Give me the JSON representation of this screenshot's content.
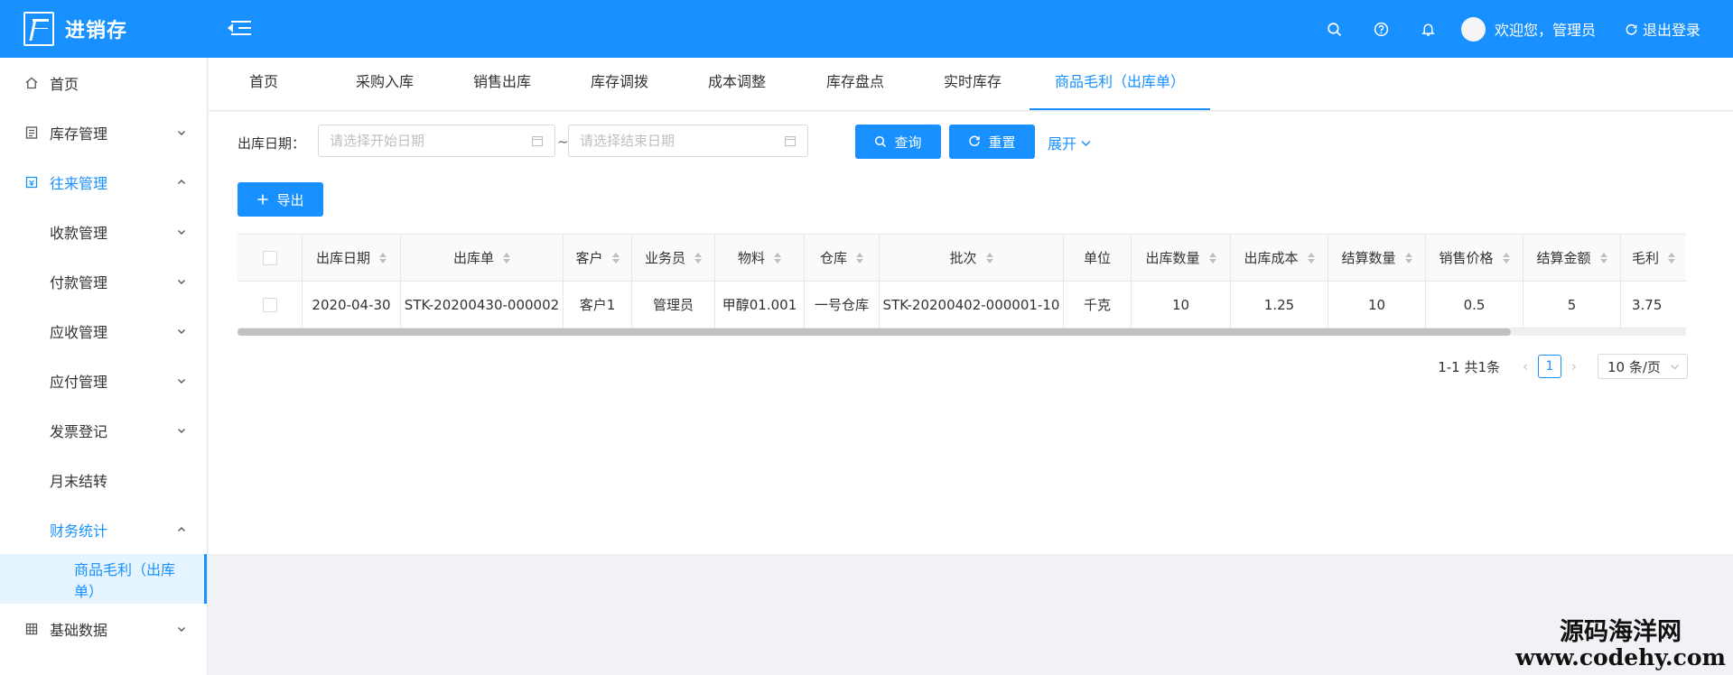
{
  "header": {
    "app_title": "进销存",
    "welcome": "欢迎您，管理员",
    "logout": "退出登录"
  },
  "sidebar": {
    "items": [
      {
        "label": "首页",
        "icon": "home-icon"
      },
      {
        "label": "库存管理",
        "icon": "list-icon"
      },
      {
        "label": "往来管理",
        "icon": "calendar-icon"
      },
      {
        "label": "收款管理"
      },
      {
        "label": "付款管理"
      },
      {
        "label": "应收管理"
      },
      {
        "label": "应付管理"
      },
      {
        "label": "发票登记"
      },
      {
        "label": "月末结转"
      },
      {
        "label": "财务统计"
      },
      {
        "label": "商品毛利（出库单）"
      },
      {
        "label": "基础数据",
        "icon": "grid-icon"
      }
    ]
  },
  "tabs": [
    "首页",
    "采购入库",
    "销售出库",
    "库存调拨",
    "成本调整",
    "库存盘点",
    "实时库存",
    "商品毛利（出库单）"
  ],
  "search": {
    "date_label": "出库日期：",
    "start_placeholder": "请选择开始日期",
    "end_placeholder": "请选择结束日期",
    "tilde": "~",
    "query": "查询",
    "reset": "重置",
    "expand": "展开"
  },
  "toolbar": {
    "export": "导出"
  },
  "table": {
    "columns": [
      "出库日期",
      "出库单",
      "客户",
      "业务员",
      "物料",
      "仓库",
      "批次",
      "单位",
      "出库数量",
      "出库成本",
      "结算数量",
      "销售价格",
      "结算金额",
      "毛利"
    ],
    "rows": [
      [
        "2020-04-30",
        "STK-20200430-000002",
        "客户1",
        "管理员",
        "甲醇01.001",
        "一号仓库",
        "STK-20200402-000001-10",
        "千克",
        "10",
        "1.25",
        "10",
        "0.5",
        "5",
        "3.75"
      ]
    ]
  },
  "pagination": {
    "summary": "1-1 共1条",
    "current": "1",
    "page_size": "10 条/页"
  },
  "watermark": {
    "line1": "源码海洋网",
    "line2": "www.codehy.com"
  },
  "colors": {
    "primary": "#1890ff",
    "background": "#f0f2f5"
  }
}
